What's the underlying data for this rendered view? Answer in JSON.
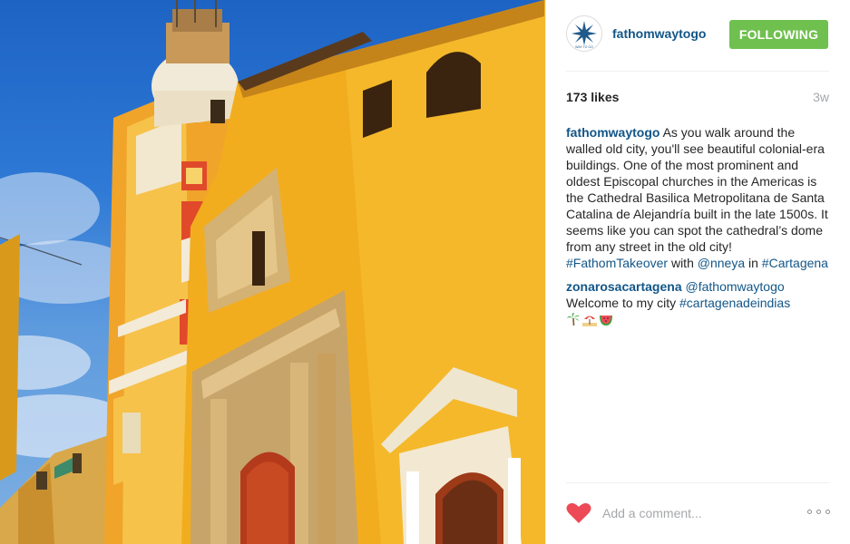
{
  "account": {
    "username": "fathomwaytogo",
    "avatar_caption": "WAY TO GO",
    "follow_label": "FOLLOWING"
  },
  "post": {
    "likes": "173 likes",
    "time_ago": "3w",
    "image_icon": "cathedral-photo"
  },
  "caption": {
    "user": "fathomwaytogo",
    "text_part1": " As you walk around the walled old city, you'll see beautiful colonial-era buildings. One of the most prominent and oldest Episcopal churches in the Americas is the Cathedral Basilica Metropolitana de Santa Catalina de Alejandría built in the late 1500s. It seems like you can spot the cathedral’s dome from any street in the old city! ",
    "hashtag1": "#FathomTakeover",
    "text_part2": " with ",
    "mention": "@nneya",
    "text_part3": " in ",
    "hashtag2": "#Cartagena"
  },
  "comments": [
    {
      "user": "zonarosacartagena",
      "mention": " @fathomwaytogo",
      "text": "Welcome to my city ",
      "hashtag": "#cartagenadeindias",
      "emojis": [
        "palm-tree-emoji",
        "beach-umbrella-emoji",
        "watermelon-emoji"
      ]
    }
  ],
  "comment_box": {
    "placeholder": "Add a comment...",
    "like_icon": "heart-icon",
    "more_icon": "more-options-icon"
  },
  "colors": {
    "link": "#125688",
    "follow_button": "#70c050",
    "heart": "#ed4956",
    "muted": "#a5a7aa"
  }
}
